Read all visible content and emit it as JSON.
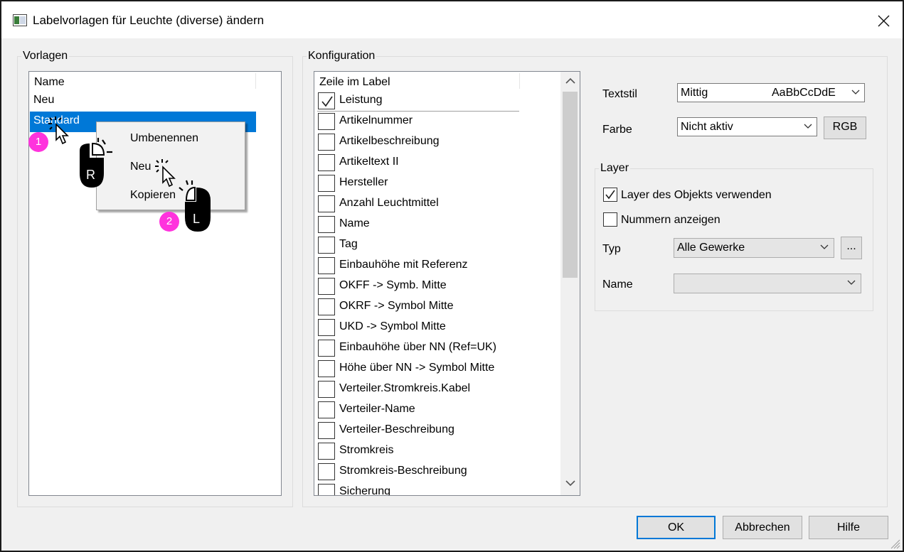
{
  "window": {
    "title": "Labelvorlagen für Leuchte (diverse) ändern",
    "icons": {
      "app": "window-app-icon",
      "close": "close-icon"
    }
  },
  "vorlagen": {
    "legend": "Vorlagen",
    "column_header": "Name",
    "items": [
      {
        "label": "Neu",
        "selected": false
      },
      {
        "label": "Standard",
        "selected": true
      }
    ],
    "context_menu": {
      "items": [
        "Umbenennen",
        "Neu",
        "Kopieren"
      ]
    }
  },
  "konfiguration": {
    "legend": "Konfiguration",
    "column_header": "Zeile im Label",
    "rows": [
      {
        "label": "Leistung",
        "checked": true
      },
      {
        "label": "Artikelnummer",
        "checked": false
      },
      {
        "label": "Artikelbeschreibung",
        "checked": false
      },
      {
        "label": "Artikeltext II",
        "checked": false
      },
      {
        "label": "Hersteller",
        "checked": false
      },
      {
        "label": "Anzahl Leuchtmittel",
        "checked": false
      },
      {
        "label": "Name",
        "checked": false
      },
      {
        "label": "Tag",
        "checked": false
      },
      {
        "label": "Einbauhöhe mit Referenz",
        "checked": false
      },
      {
        "label": "OKFF -> Symb. Mitte",
        "checked": false
      },
      {
        "label": "OKRF -> Symbol Mitte",
        "checked": false
      },
      {
        "label": "UKD -> Symbol Mitte",
        "checked": false
      },
      {
        "label": "Einbauhöhe über NN (Ref=UK)",
        "checked": false
      },
      {
        "label": "Höhe über NN -> Symbol Mitte",
        "checked": false
      },
      {
        "label": "Verteiler.Stromkreis.Kabel",
        "checked": false
      },
      {
        "label": "Verteiler-Name",
        "checked": false
      },
      {
        "label": "Verteiler-Beschreibung",
        "checked": false
      },
      {
        "label": "Stromkreis",
        "checked": false
      },
      {
        "label": "Stromkreis-Beschreibung",
        "checked": false
      },
      {
        "label": "Sicherung",
        "checked": false
      }
    ],
    "textstil": {
      "label": "Textstil",
      "value": "Mittig",
      "preview": "AaBbCcDdE"
    },
    "farbe": {
      "label": "Farbe",
      "value": "Nicht aktiv",
      "rgb_button": "RGB"
    },
    "layer": {
      "legend": "Layer",
      "use_object_layer": {
        "label": "Layer des Objekts verwenden",
        "checked": true
      },
      "show_numbers": {
        "label": "Nummern anzeigen",
        "checked": false
      },
      "typ": {
        "label": "Typ",
        "value": "Alle Gewerke",
        "browse_button": "..."
      },
      "name": {
        "label": "Name",
        "value": ""
      }
    }
  },
  "footer": {
    "ok": "OK",
    "cancel": "Abbrechen",
    "help": "Hilfe"
  },
  "annotations": {
    "step1": {
      "number": "1",
      "mouse_button": "R"
    },
    "step2": {
      "number": "2",
      "mouse_button": "L"
    }
  }
}
